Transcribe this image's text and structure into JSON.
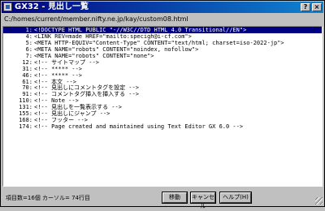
{
  "window": {
    "title": "GX32 - 見出し一覧",
    "help_label": "?",
    "close_label": "×"
  },
  "path": "C:/homes/current/member.nifty.ne.jp/kay/custom08.html",
  "headings": [
    {
      "line": "1:",
      "text": "<!DOCTYPE HTML PUBLIC \"-//W3C//DTD HTML 4.0 Transitional//EN\">",
      "selected": true
    },
    {
      "line": "4:",
      "text": "<LINK REV=made HREF=\"mailto:specigh@i-cf.com\">"
    },
    {
      "line": "5:",
      "text": "<META HTTP-EQUIV=\"Content-Type\" CONTENT=\"text/html; charset=iso-2022-jp\">"
    },
    {
      "line": "6:",
      "text": "<META NAME=\"robots\" CONTENT=\"noindex, nofollow\">"
    },
    {
      "line": "7:",
      "text": "<META NAME=\"robots\" CONTENT=\"none\">"
    },
    {
      "line": "12:",
      "text": "<!-- サイトマップ -->"
    },
    {
      "line": "31:",
      "text": "<!-- ***** -->"
    },
    {
      "line": "46:",
      "text": "<!-- ***** -->"
    },
    {
      "line": "61:",
      "text": "<!-- 本文 -->"
    },
    {
      "line": "70:",
      "text": "<!-- 見出しにコメントタグを設定 -->"
    },
    {
      "line": "91:",
      "text": "<!-- コメントタグ挿入を挿入する -->"
    },
    {
      "line": "110:",
      "text": "<!-- Note -->"
    },
    {
      "line": "131:",
      "text": "<!-- 見出しを一覧表示する -->"
    },
    {
      "line": "155:",
      "text": "<!-- 見出しにジャンプ -->"
    },
    {
      "line": "168:",
      "text": "<!-- フッター -->"
    },
    {
      "line": "174:",
      "text": "<!-- Page created and maintained using Text Editor GX 6.0 -->"
    }
  ],
  "status": "項目数=16個 カーソル= 74行目",
  "buttons": {
    "move": "移動",
    "cancel": "キャンセル",
    "help": "ヘルプ(H)"
  }
}
